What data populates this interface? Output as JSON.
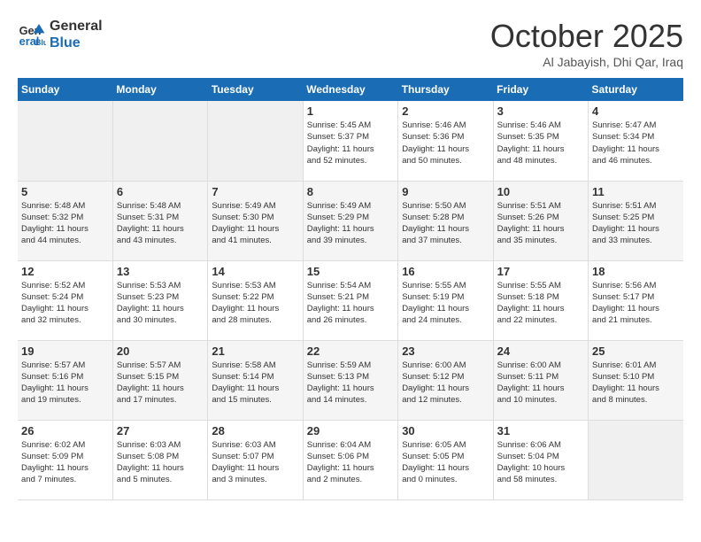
{
  "logo": {
    "line1": "General",
    "line2": "Blue"
  },
  "header": {
    "month": "October 2025",
    "location": "Al Jabayish, Dhi Qar, Iraq"
  },
  "weekdays": [
    "Sunday",
    "Monday",
    "Tuesday",
    "Wednesday",
    "Thursday",
    "Friday",
    "Saturday"
  ],
  "weeks": [
    [
      {
        "day": "",
        "info": ""
      },
      {
        "day": "",
        "info": ""
      },
      {
        "day": "",
        "info": ""
      },
      {
        "day": "1",
        "info": "Sunrise: 5:45 AM\nSunset: 5:37 PM\nDaylight: 11 hours\nand 52 minutes."
      },
      {
        "day": "2",
        "info": "Sunrise: 5:46 AM\nSunset: 5:36 PM\nDaylight: 11 hours\nand 50 minutes."
      },
      {
        "day": "3",
        "info": "Sunrise: 5:46 AM\nSunset: 5:35 PM\nDaylight: 11 hours\nand 48 minutes."
      },
      {
        "day": "4",
        "info": "Sunrise: 5:47 AM\nSunset: 5:34 PM\nDaylight: 11 hours\nand 46 minutes."
      }
    ],
    [
      {
        "day": "5",
        "info": "Sunrise: 5:48 AM\nSunset: 5:32 PM\nDaylight: 11 hours\nand 44 minutes."
      },
      {
        "day": "6",
        "info": "Sunrise: 5:48 AM\nSunset: 5:31 PM\nDaylight: 11 hours\nand 43 minutes."
      },
      {
        "day": "7",
        "info": "Sunrise: 5:49 AM\nSunset: 5:30 PM\nDaylight: 11 hours\nand 41 minutes."
      },
      {
        "day": "8",
        "info": "Sunrise: 5:49 AM\nSunset: 5:29 PM\nDaylight: 11 hours\nand 39 minutes."
      },
      {
        "day": "9",
        "info": "Sunrise: 5:50 AM\nSunset: 5:28 PM\nDaylight: 11 hours\nand 37 minutes."
      },
      {
        "day": "10",
        "info": "Sunrise: 5:51 AM\nSunset: 5:26 PM\nDaylight: 11 hours\nand 35 minutes."
      },
      {
        "day": "11",
        "info": "Sunrise: 5:51 AM\nSunset: 5:25 PM\nDaylight: 11 hours\nand 33 minutes."
      }
    ],
    [
      {
        "day": "12",
        "info": "Sunrise: 5:52 AM\nSunset: 5:24 PM\nDaylight: 11 hours\nand 32 minutes."
      },
      {
        "day": "13",
        "info": "Sunrise: 5:53 AM\nSunset: 5:23 PM\nDaylight: 11 hours\nand 30 minutes."
      },
      {
        "day": "14",
        "info": "Sunrise: 5:53 AM\nSunset: 5:22 PM\nDaylight: 11 hours\nand 28 minutes."
      },
      {
        "day": "15",
        "info": "Sunrise: 5:54 AM\nSunset: 5:21 PM\nDaylight: 11 hours\nand 26 minutes."
      },
      {
        "day": "16",
        "info": "Sunrise: 5:55 AM\nSunset: 5:19 PM\nDaylight: 11 hours\nand 24 minutes."
      },
      {
        "day": "17",
        "info": "Sunrise: 5:55 AM\nSunset: 5:18 PM\nDaylight: 11 hours\nand 22 minutes."
      },
      {
        "day": "18",
        "info": "Sunrise: 5:56 AM\nSunset: 5:17 PM\nDaylight: 11 hours\nand 21 minutes."
      }
    ],
    [
      {
        "day": "19",
        "info": "Sunrise: 5:57 AM\nSunset: 5:16 PM\nDaylight: 11 hours\nand 19 minutes."
      },
      {
        "day": "20",
        "info": "Sunrise: 5:57 AM\nSunset: 5:15 PM\nDaylight: 11 hours\nand 17 minutes."
      },
      {
        "day": "21",
        "info": "Sunrise: 5:58 AM\nSunset: 5:14 PM\nDaylight: 11 hours\nand 15 minutes."
      },
      {
        "day": "22",
        "info": "Sunrise: 5:59 AM\nSunset: 5:13 PM\nDaylight: 11 hours\nand 14 minutes."
      },
      {
        "day": "23",
        "info": "Sunrise: 6:00 AM\nSunset: 5:12 PM\nDaylight: 11 hours\nand 12 minutes."
      },
      {
        "day": "24",
        "info": "Sunrise: 6:00 AM\nSunset: 5:11 PM\nDaylight: 11 hours\nand 10 minutes."
      },
      {
        "day": "25",
        "info": "Sunrise: 6:01 AM\nSunset: 5:10 PM\nDaylight: 11 hours\nand 8 minutes."
      }
    ],
    [
      {
        "day": "26",
        "info": "Sunrise: 6:02 AM\nSunset: 5:09 PM\nDaylight: 11 hours\nand 7 minutes."
      },
      {
        "day": "27",
        "info": "Sunrise: 6:03 AM\nSunset: 5:08 PM\nDaylight: 11 hours\nand 5 minutes."
      },
      {
        "day": "28",
        "info": "Sunrise: 6:03 AM\nSunset: 5:07 PM\nDaylight: 11 hours\nand 3 minutes."
      },
      {
        "day": "29",
        "info": "Sunrise: 6:04 AM\nSunset: 5:06 PM\nDaylight: 11 hours\nand 2 minutes."
      },
      {
        "day": "30",
        "info": "Sunrise: 6:05 AM\nSunset: 5:05 PM\nDaylight: 11 hours\nand 0 minutes."
      },
      {
        "day": "31",
        "info": "Sunrise: 6:06 AM\nSunset: 5:04 PM\nDaylight: 10 hours\nand 58 minutes."
      },
      {
        "day": "",
        "info": ""
      }
    ]
  ]
}
